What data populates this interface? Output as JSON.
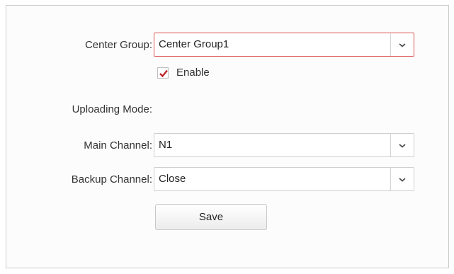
{
  "form": {
    "center_group": {
      "label": "Center Group:",
      "value": "Center Group1"
    },
    "enable": {
      "label": "Enable",
      "checked": true
    },
    "uploading_mode": {
      "label": "Uploading Mode:"
    },
    "main_channel": {
      "label": "Main Channel:",
      "value": "N1"
    },
    "backup_channel": {
      "label": "Backup Channel:",
      "value": "Close"
    },
    "save_label": "Save"
  },
  "icons": {
    "dropdown": "chevron-down-icon",
    "checkmark": "check-icon"
  },
  "colors": {
    "focus_border": "#d9534f",
    "check": "#c0262c"
  }
}
